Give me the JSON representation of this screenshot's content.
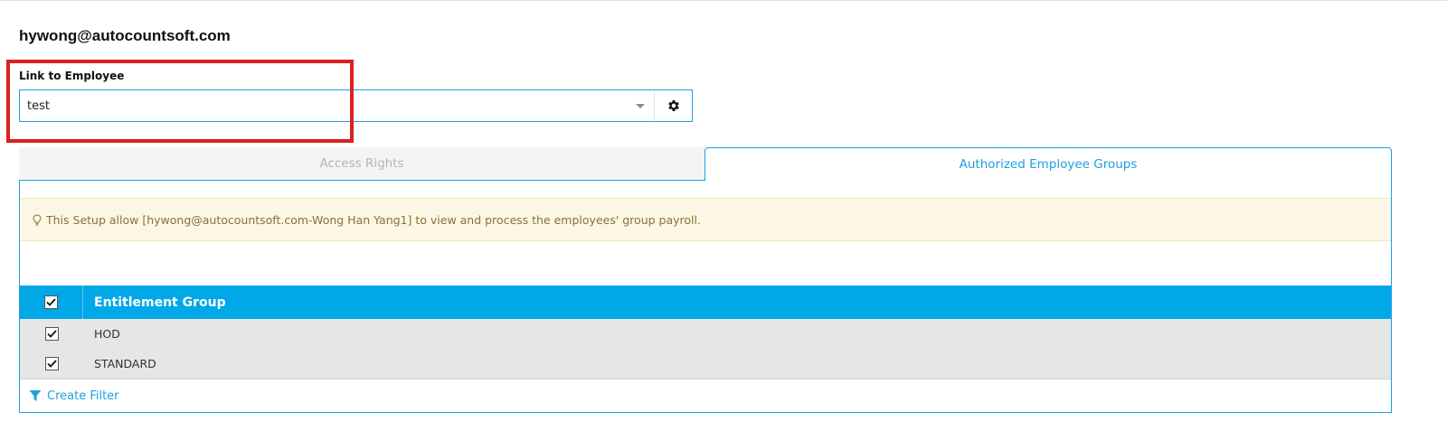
{
  "header": {
    "user_email": "hywong@autocountsoft.com"
  },
  "link_employee": {
    "label": "Link to Employee",
    "value": "test",
    "dropdown_icon": "chevron-down-icon",
    "settings_icon": "gear-icon"
  },
  "tabs": [
    {
      "label": "Access Rights",
      "active": false
    },
    {
      "label": "Authorized Employee Groups",
      "active": true
    }
  ],
  "info": {
    "icon": "lightbulb-icon",
    "text": "This Setup allow [hywong@autocountsoft.com-Wong Han Yang1] to view and process the employees' group payroll."
  },
  "grid": {
    "header_checked": true,
    "column_title": "Entitlement Group",
    "rows": [
      {
        "label": "HOD",
        "checked": true
      },
      {
        "label": "STANDARD",
        "checked": true
      }
    ]
  },
  "footer": {
    "create_filter_label": "Create Filter",
    "filter_icon": "funnel-icon"
  },
  "colors": {
    "accent": "#1ea0e0",
    "grid_header": "#00a8e8",
    "highlight": "#dc1f1f",
    "info_bg": "#fcf7e4"
  }
}
